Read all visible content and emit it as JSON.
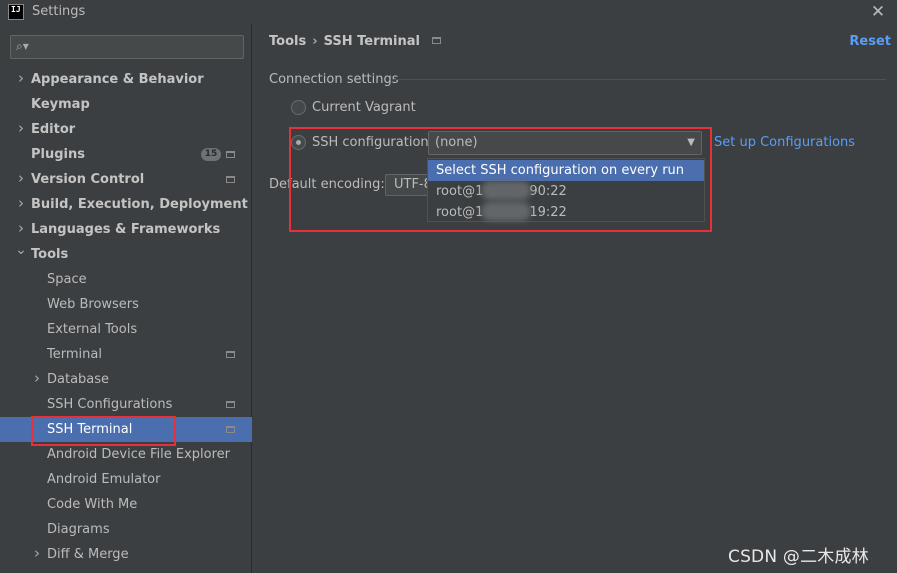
{
  "window": {
    "logo_text": "IJ",
    "title": "Settings",
    "close_glyph": "✕"
  },
  "search": {
    "icon": "search-icon",
    "value": "",
    "placeholder": ""
  },
  "tree": {
    "items": [
      {
        "label": "Appearance & Behavior",
        "level": 0,
        "expander": "collapsed"
      },
      {
        "label": "Keymap",
        "level": 0,
        "expander": "none"
      },
      {
        "label": "Editor",
        "level": 0,
        "expander": "collapsed"
      },
      {
        "label": "Plugins",
        "level": 0,
        "expander": "none",
        "badge": "15",
        "project_icon": true
      },
      {
        "label": "Version Control",
        "level": 0,
        "expander": "collapsed",
        "project_icon": true
      },
      {
        "label": "Build, Execution, Deployment",
        "level": 0,
        "expander": "collapsed"
      },
      {
        "label": "Languages & Frameworks",
        "level": 0,
        "expander": "collapsed"
      },
      {
        "label": "Tools",
        "level": 0,
        "expander": "expanded"
      },
      {
        "label": "Space",
        "level": 1,
        "expander": "none"
      },
      {
        "label": "Web Browsers",
        "level": 1,
        "expander": "none"
      },
      {
        "label": "External Tools",
        "level": 1,
        "expander": "none"
      },
      {
        "label": "Terminal",
        "level": 1,
        "expander": "none",
        "project_icon": true
      },
      {
        "label": "Database",
        "level": 1,
        "expander": "collapsed"
      },
      {
        "label": "SSH Configurations",
        "level": 1,
        "expander": "none",
        "project_icon": true
      },
      {
        "label": "SSH Terminal",
        "level": 1,
        "expander": "none",
        "project_icon": true,
        "selected": true
      },
      {
        "label": "Android Device File Explorer",
        "level": 1,
        "expander": "none"
      },
      {
        "label": "Android Emulator",
        "level": 1,
        "expander": "none"
      },
      {
        "label": "Code With Me",
        "level": 1,
        "expander": "none"
      },
      {
        "label": "Diagrams",
        "level": 1,
        "expander": "none"
      },
      {
        "label": "Diff & Merge",
        "level": 1,
        "expander": "collapsed"
      }
    ]
  },
  "content": {
    "breadcrumb": {
      "parent": "Tools",
      "separator": "›",
      "current": "SSH Terminal"
    },
    "reset_label": "Reset",
    "section_title": "Connection settings",
    "radio_vagrant_label": "Current Vagrant",
    "radio_ssh_label": "SSH configuration",
    "ssh_combo_value": "(none)",
    "combo_arrow": "▼",
    "setup_link": "Set up Configurations",
    "dropdown": {
      "items": [
        {
          "prefix": "Select SSH configuration on every run",
          "suffix": ""
        },
        {
          "prefix": "root@1",
          "suffix": "90:22"
        },
        {
          "prefix": "root@1",
          "suffix": "19:22"
        }
      ]
    },
    "encoding_label": "Default encoding:",
    "encoding_value": "UTF-8"
  },
  "watermark": "CSDN @二木成林",
  "colors": {
    "background": "#3c3f41",
    "selection": "#4b6eaf",
    "link": "#589df6",
    "highlight_box": "#e8303a"
  }
}
